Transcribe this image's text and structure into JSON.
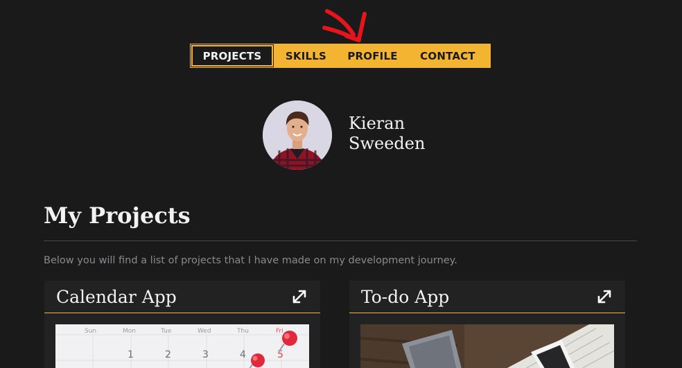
{
  "nav": {
    "items": [
      {
        "label": "PROJECTS",
        "active": true
      },
      {
        "label": "SKILLS",
        "active": false
      },
      {
        "label": "PROFILE",
        "active": false
      },
      {
        "label": "CONTACT",
        "active": false
      }
    ]
  },
  "profile": {
    "first_name": "Kieran",
    "last_name": "Sweeden"
  },
  "projects_section": {
    "title": "My Projects",
    "subtitle": "Below you will find a list of projects that I have made on my development journey."
  },
  "cards": [
    {
      "title": "Calendar App",
      "icon": "expand-icon"
    },
    {
      "title": "To-do App",
      "icon": "expand-icon"
    }
  ],
  "calendar_image": {
    "days": [
      "Sun",
      "Mon",
      "Tue",
      "Wed",
      "Thu",
      "Fri"
    ],
    "numbers": [
      "1",
      "2",
      "3",
      "4",
      "5"
    ]
  },
  "colors": {
    "background": "#1b1a1b",
    "accent": "#f2b431",
    "card": "#232223",
    "annotation": "#e8141c"
  }
}
